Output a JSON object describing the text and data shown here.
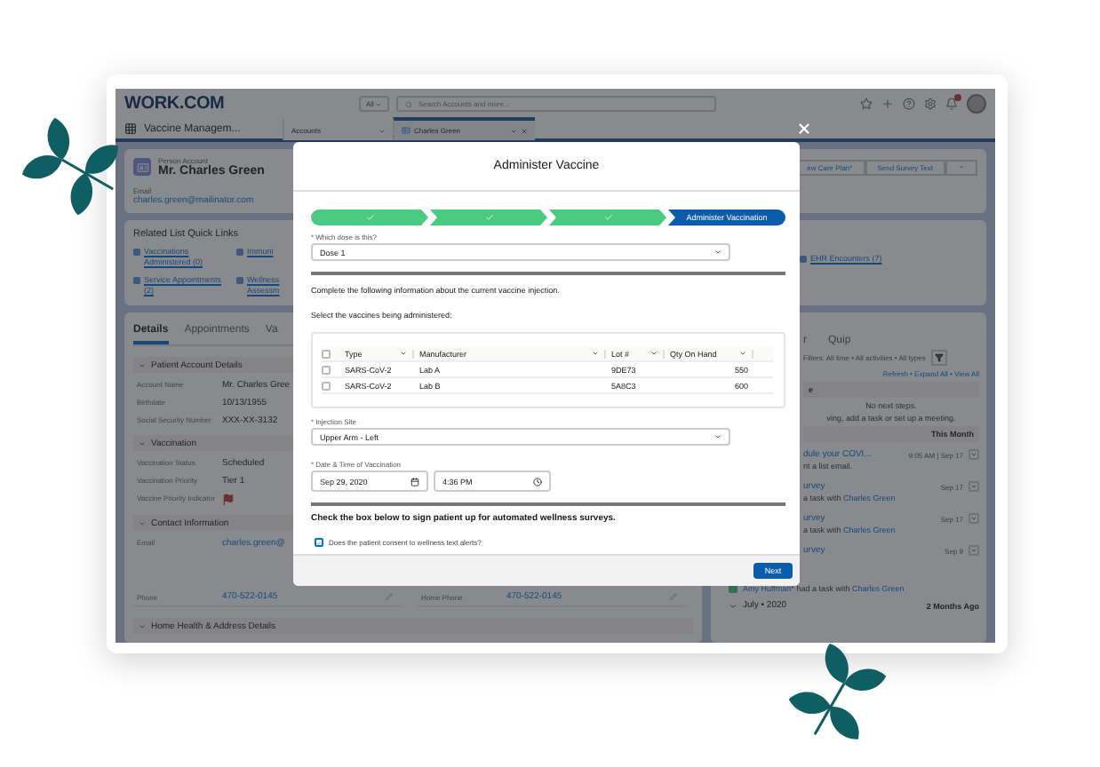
{
  "header": {
    "logo": "WORK.COM",
    "search_scope": "All",
    "search_placeholder": "Search Accounts and more..."
  },
  "nav": {
    "app_name": "Vaccine Managem...",
    "tabs": [
      {
        "label": "Accounts",
        "selected": false
      },
      {
        "label": "Charles Green",
        "selected": true
      }
    ]
  },
  "record": {
    "type": "Person Account",
    "name": "Mr. Charles Green",
    "actions": [
      "ew Care Plan*",
      "Send Survey Text"
    ],
    "email_label": "Email",
    "email": "charles.green@mailinator.com"
  },
  "quick_links": {
    "title": "Related List Quick Links",
    "links": [
      "Vaccinations Administered (0)",
      "Immuni",
      "Service Appointments (2)",
      "Wellness Assessm",
      "EHR Encounters (7)"
    ]
  },
  "detail_tabs": [
    {
      "label": "Details",
      "selected": true
    },
    {
      "label": "Appointments",
      "selected": false
    },
    {
      "label": "Va",
      "selected": false
    }
  ],
  "sections": [
    {
      "title": "Patient Account Details",
      "rows": [
        [
          {
            "label": "Account Name",
            "value": "Mr. Charles Gree"
          }
        ],
        [
          {
            "label": "Birthdate",
            "value": "10/13/1955"
          }
        ],
        [
          {
            "label": "Social Security Number",
            "value": "XXX-XX-3132"
          }
        ]
      ]
    },
    {
      "title": "Vaccination",
      "rows": [
        [
          {
            "label": "Vaccination Status",
            "value": "Scheduled"
          }
        ],
        [
          {
            "label": "Vaccination Priority",
            "value": "Tier 1"
          }
        ],
        [
          {
            "label": "Vaccine Priority Indicator",
            "kind": "flag"
          }
        ]
      ]
    },
    {
      "title": "Contact Information",
      "rows": [
        [
          {
            "label": "Email",
            "value": "charles.green@",
            "kind": "link"
          }
        ],
        [
          {
            "label": "Phone",
            "value": "470-522-0145",
            "kind": "link"
          },
          {
            "label": "Home Phone",
            "value": "470-522-0145",
            "kind": "link"
          }
        ]
      ]
    },
    {
      "title": "Home Health & Address Details"
    }
  ],
  "activity": {
    "tabs": [
      "r",
      "Quip"
    ],
    "filters": "Filters: All time • All activities • All types",
    "links": "Refresh • Expand All • View All",
    "upcoming_title": "e",
    "empty_title": "No next steps.",
    "empty_text": "ving, add a task or set up a meeting.",
    "month": "This Month",
    "items": [
      {
        "title": "dule your COVI...",
        "time": "9:05 AM | Sep 17",
        "text": "nt a list email."
      },
      {
        "title": "urvey",
        "time": "Sep 17",
        "text": "a task with ",
        "link": "Charles Green"
      },
      {
        "title": "urvey",
        "time": "Sep 17",
        "text": "a task with ",
        "link": "Charles Green"
      },
      {
        "title": "urvey",
        "time": "Sep 9",
        "actor": "Amy Huffman*",
        "text": " had a task with ",
        "link": "Charles Green"
      }
    ],
    "older_group": "July • 2020",
    "older_label": "2 Months Ago"
  },
  "modal": {
    "title": "Administer Vaccine",
    "steps": [
      {
        "complete": true,
        "selected": false
      },
      {
        "complete": true,
        "selected": false
      },
      {
        "complete": true,
        "selected": false
      },
      {
        "complete": false,
        "selected": true,
        "label": "Administer Vaccination"
      }
    ],
    "dose": {
      "mark": "*",
      "label": "Which dose is this?",
      "value": "Dose 1"
    },
    "intro": "Complete the following information about the current vaccine injection.",
    "select_label": "Select the vaccines being administered:",
    "table": {
      "all_checked": false,
      "columns": [
        "Type",
        "Manufacturer",
        "Lot #",
        "Qty On Hand"
      ],
      "rows": [
        {
          "cells": [
            "SARS-CoV-2",
            "Lab A",
            "9DE73",
            "550"
          ],
          "checked": false
        },
        {
          "cells": [
            "SARS-CoV-2",
            "Lab B",
            "5A8C3",
            "600"
          ],
          "checked": false
        }
      ]
    },
    "site": {
      "mark": "*",
      "label": "Injection Site",
      "value": "Upper Arm - Left"
    },
    "datetime": {
      "mark": "*",
      "label": "Date & Time of Vaccination",
      "date": "Sep 29, 2020",
      "time": "4:36 PM"
    },
    "survey_note": "Check the box below to sign patient up for automated wellness surveys.",
    "consent": {
      "label": "Does the patient consent to wellness text alerts?",
      "checked": true
    },
    "next": "Next"
  }
}
